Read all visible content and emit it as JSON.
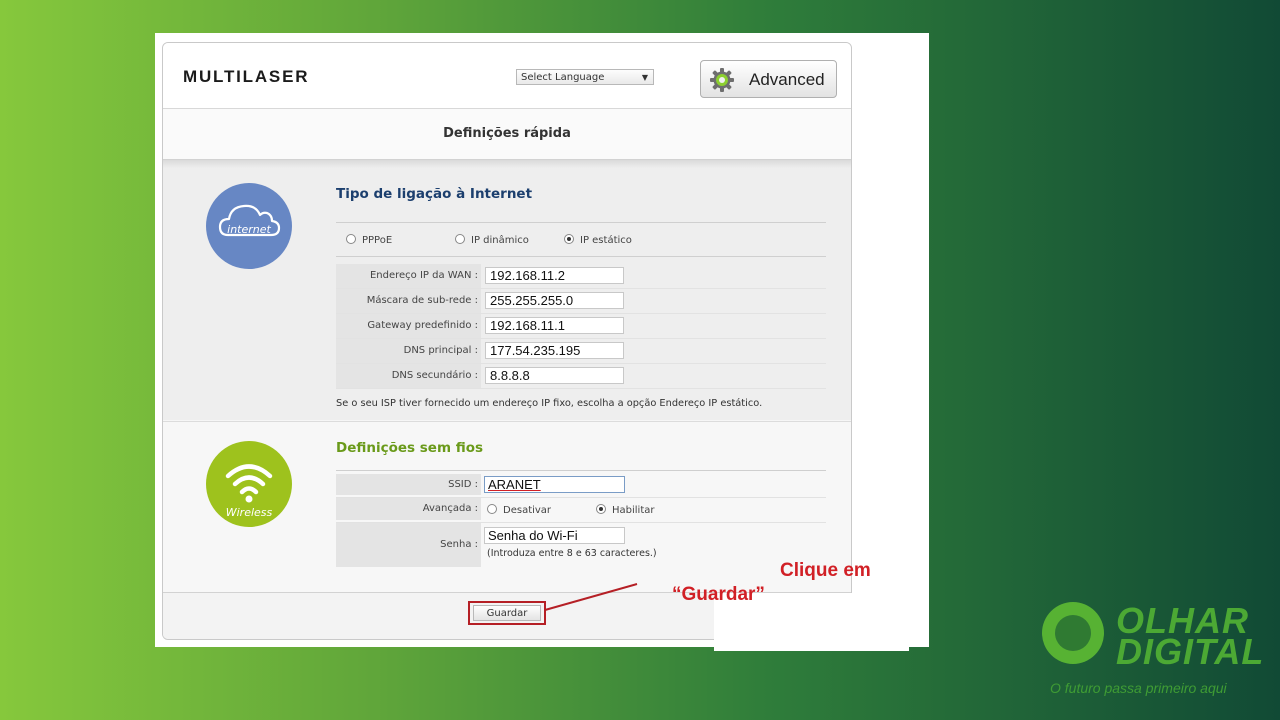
{
  "header": {
    "brand": "MULTILASER",
    "language_select": "Select Language",
    "advanced_button": "Advanced"
  },
  "page_title": "Definições rápida",
  "internet": {
    "icon_label": "internet",
    "title": "Tipo de ligação à Internet",
    "connection_types": [
      {
        "label": "PPPoE",
        "selected": false
      },
      {
        "label": "IP dinâmico",
        "selected": false
      },
      {
        "label": "IP estático",
        "selected": true
      }
    ],
    "fields": [
      {
        "label": "Endereço IP da WAN :",
        "value": "192.168.11.2"
      },
      {
        "label": "Máscara de sub-rede :",
        "value": "255.255.255.0"
      },
      {
        "label": "Gateway predefinido :",
        "value": "192.168.11.1"
      },
      {
        "label": "DNS principal :",
        "value": "177.54.235.195"
      },
      {
        "label": "DNS secundário :",
        "value": "8.8.8.8"
      }
    ],
    "note": "Se o seu ISP tiver fornecido um endereço IP fixo, escolha a opção Endereço IP estático."
  },
  "wireless": {
    "icon_label": "Wireless",
    "title": "Definições sem fios",
    "ssid_label": "SSID :",
    "ssid_value": "ARANET",
    "advanced_label": "Avançada :",
    "advanced_options": [
      {
        "label": "Desativar",
        "selected": false
      },
      {
        "label": "Habilitar",
        "selected": true
      }
    ],
    "password_label": "Senha :",
    "password_value": "Senha do Wi-Fi",
    "password_hint": "(Introduza entre 8 e 63 caracteres.)"
  },
  "save_button": "Guardar",
  "annotation": {
    "line1": "Clique em",
    "line2": "“Guardar”"
  },
  "watermark": {
    "word1": "OLHAR",
    "word2": "DIGITAL",
    "tagline": "O futuro passa primeiro aqui"
  },
  "colors": {
    "internet_circle": "#6787c4",
    "wireless_circle": "#9ec21d",
    "internet_title": "#1c3f6e",
    "wireless_title": "#6a9a1a",
    "annotation_red": "#d12026"
  }
}
